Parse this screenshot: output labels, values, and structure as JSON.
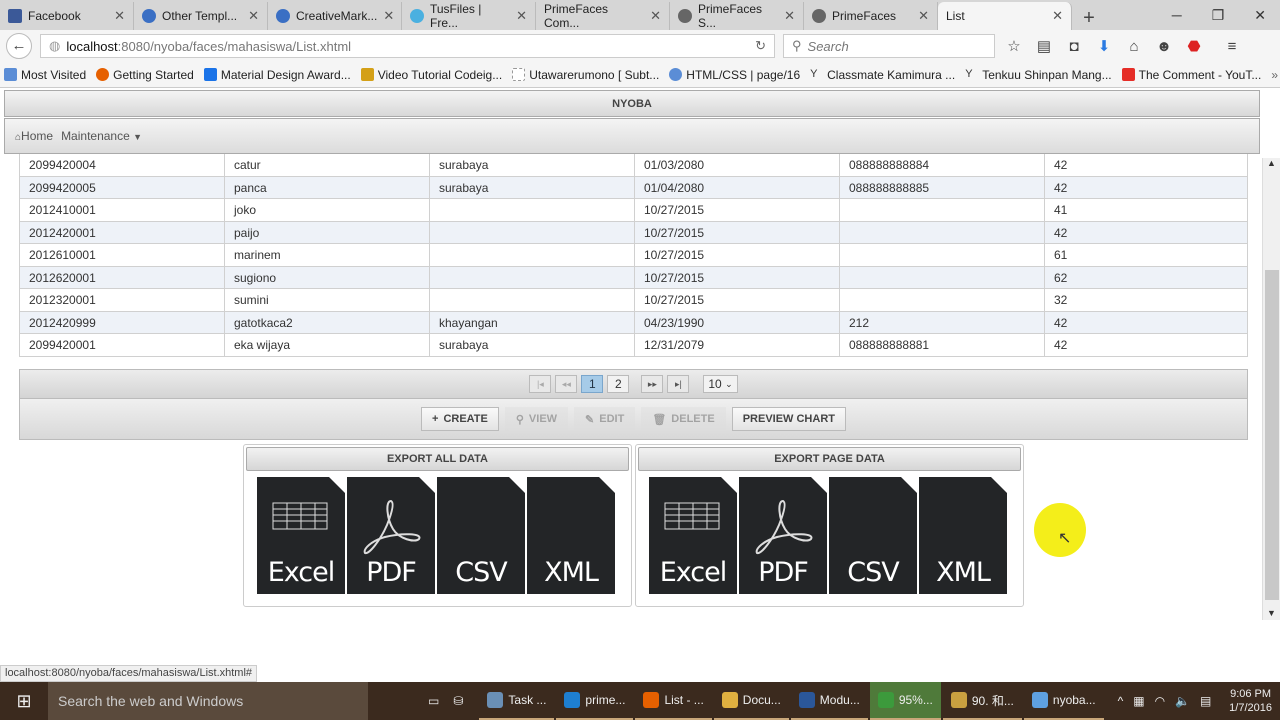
{
  "browser": {
    "tabs": [
      {
        "label": "Facebook"
      },
      {
        "label": "Other Templ..."
      },
      {
        "label": "CreativeMark..."
      },
      {
        "label": "TusFiles | Fre..."
      },
      {
        "label": "PrimeFaces Com..."
      },
      {
        "label": "PrimeFaces S..."
      },
      {
        "label": "PrimeFaces"
      },
      {
        "label": "List",
        "active": true
      }
    ],
    "url_host": "localhost",
    "url_rest": ":8080/nyoba/faces/mahasiswa/List.xhtml",
    "search_placeholder": "Search",
    "bookmarks": [
      "Most Visited",
      "Getting Started",
      "Material Design Award...",
      "Video Tutorial Codeig...",
      "Utawarerumono [ Subt...",
      "HTML/CSS | page/16",
      "Classmate Kamimura ...",
      "Tenkuu Shinpan Mang...",
      "The Comment - YouT..."
    ],
    "status_url": "localhost:8080/nyoba/faces/mahasiswa/List.xhtml#"
  },
  "app": {
    "title": "NYOBA",
    "menu": {
      "home": "Home",
      "maintenance": "Maintenance"
    },
    "table_rows": [
      [
        "2099420004",
        "catur",
        "surabaya",
        "01/03/2080",
        "088888888884",
        "42"
      ],
      [
        "2099420005",
        "panca",
        "surabaya",
        "01/04/2080",
        "088888888885",
        "42"
      ],
      [
        "2012410001",
        "joko",
        "",
        "10/27/2015",
        "",
        "41"
      ],
      [
        "2012420001",
        "paijo",
        "",
        "10/27/2015",
        "",
        "42"
      ],
      [
        "2012610001",
        "marinem",
        "",
        "10/27/2015",
        "",
        "61"
      ],
      [
        "2012620001",
        "sugiono",
        "",
        "10/27/2015",
        "",
        "62"
      ],
      [
        "2012320001",
        "sumini",
        "",
        "10/27/2015",
        "",
        "32"
      ],
      [
        "2012420999",
        "gatotkaca2",
        "khayangan",
        "04/23/1990",
        "212",
        "42"
      ],
      [
        "2099420001",
        "eka wijaya",
        "surabaya",
        "12/31/2079",
        "088888888881",
        "42"
      ]
    ],
    "paginator": {
      "pages": [
        "1",
        "2"
      ],
      "current": "1",
      "rows_per_page": "10"
    },
    "buttons": {
      "create": "CREATE",
      "view": "VIEW",
      "edit": "EDIT",
      "delete": "DELETE",
      "preview_chart": "PREVIEW CHART"
    },
    "export_all": {
      "title": "EXPORT ALL DATA"
    },
    "export_page": {
      "title": "EXPORT PAGE DATA"
    },
    "formats": [
      "Excel",
      "PDF",
      "CSV",
      "XML"
    ]
  },
  "taskbar": {
    "search": "Search the web and Windows",
    "items": [
      "Task ...",
      "prime...",
      "List - ...",
      "Docu...",
      "Modu...",
      "95%...",
      "90. 和...",
      "nyoba..."
    ],
    "time": "9:06 PM",
    "date": "1/7/2016"
  }
}
